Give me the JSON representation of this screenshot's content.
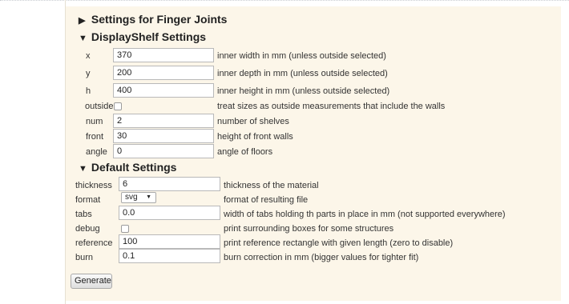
{
  "sections": {
    "finger_joints": {
      "arrow": "▶",
      "title": "Settings for Finger Joints"
    },
    "display_shelf": {
      "arrow": "▼",
      "title": "DisplayShelf Settings",
      "fields": {
        "x": {
          "label": "x",
          "value": "370",
          "desc": "inner width in mm (unless outside selected)"
        },
        "y": {
          "label": "y",
          "value": "200",
          "desc": "inner depth in mm (unless outside selected)"
        },
        "h": {
          "label": "h",
          "value": "400",
          "desc": "inner height in mm (unless outside selected)"
        },
        "outside": {
          "label": "outside",
          "checked": false,
          "desc": "treat sizes as outside measurements that include the walls"
        },
        "num": {
          "label": "num",
          "value": "2",
          "desc": "number of shelves"
        },
        "front": {
          "label": "front",
          "value": "30",
          "desc": "height of front walls"
        },
        "angle": {
          "label": "angle",
          "value": "0",
          "desc": "angle of floors"
        }
      }
    },
    "default": {
      "arrow": "▼",
      "title": "Default Settings",
      "fields": {
        "thickness": {
          "label": "thickness",
          "value": "6",
          "desc": "thickness of the material"
        },
        "format": {
          "label": "format",
          "value": "svg",
          "desc": "format of resulting file"
        },
        "tabs": {
          "label": "tabs",
          "value": "0.0",
          "desc": "width of tabs holding th parts in place in mm (not supported everywhere)"
        },
        "debug": {
          "label": "debug",
          "checked": false,
          "desc": "print surrounding boxes for some structures"
        },
        "reference": {
          "label": "reference",
          "value": "100",
          "desc": "print reference rectangle with given length (zero to disable)"
        },
        "burn": {
          "label": "burn",
          "value": "0.1",
          "desc": "burn correction in mm (bigger values for tighter fit)"
        }
      }
    }
  },
  "generate_label": "Generate",
  "icons": {
    "collapsed": "triangle-right-icon",
    "expanded": "triangle-down-icon",
    "select_arrow": "chevron-down-icon"
  }
}
